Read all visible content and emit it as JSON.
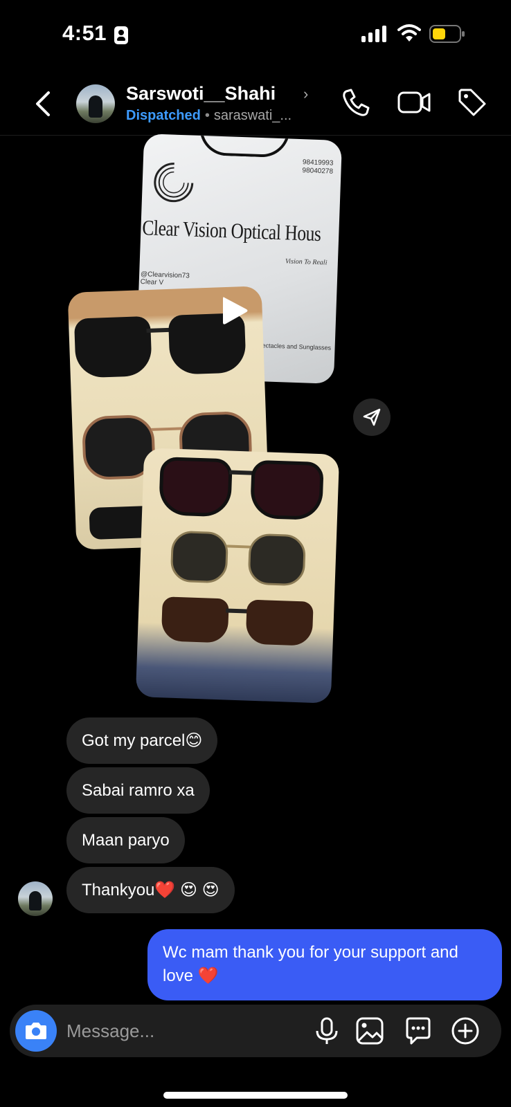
{
  "status_bar": {
    "time": "4:51"
  },
  "header": {
    "contact_name": "Sarswoti__Shahi",
    "status_label": "Dispatched",
    "separator": "•",
    "handle": "saraswati_..."
  },
  "media": {
    "bag_brand": "Clear Vision Optical Hous",
    "bag_slogan": "Vision To Reali",
    "bag_phone_1": "98419993",
    "bag_phone_2": "98040278",
    "bag_social_1": "@Clearvision73",
    "bag_social_2": "Clear V",
    "bag_footer": "Spectacles and Sunglasses"
  },
  "messages": {
    "incoming": [
      {
        "text": "Got my parcel😊"
      },
      {
        "text": "Sabai ramro xa"
      },
      {
        "text": "Maan paryo"
      },
      {
        "text": "Thankyou❤️ 😍 😍"
      }
    ],
    "outgoing": [
      {
        "text": "Wc mam thank you for your support and love ❤️"
      }
    ]
  },
  "composer": {
    "placeholder": "Message..."
  },
  "colors": {
    "background": "#000000",
    "incoming_bubble": "#262626",
    "outgoing_bubble": "#3a5cf5",
    "status_accent": "#3d9bff",
    "camera_button": "#3a82f7",
    "battery_fill": "#ffd60a"
  },
  "icons": [
    "back-icon",
    "call-icon",
    "video-call-icon",
    "tag-icon",
    "play-icon",
    "share-icon",
    "camera-icon",
    "microphone-icon",
    "gallery-icon",
    "sticker-icon",
    "plus-icon"
  ]
}
